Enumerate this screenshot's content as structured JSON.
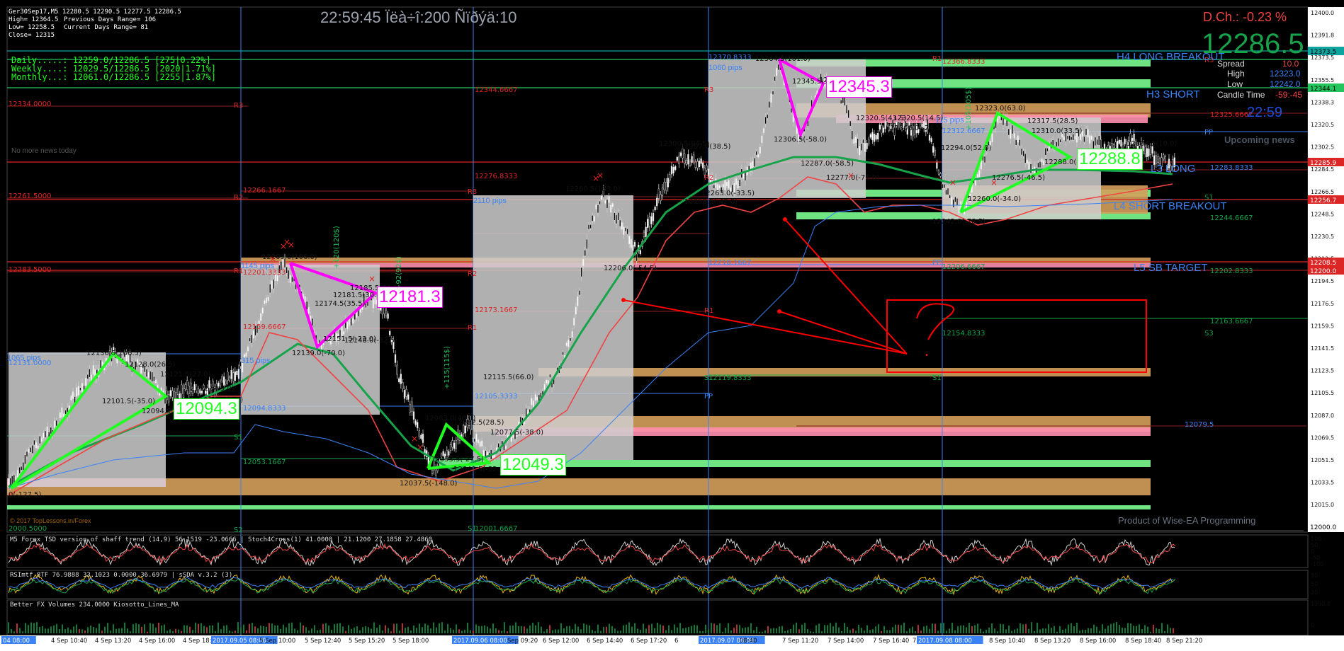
{
  "header": {
    "symbol_line": "Ger30Sep17,M5  12280.5 12290.5 12277.5 12286.5",
    "high": "High= 12364.5",
    "low": "Low= 12258.5",
    "close": "Close= 12315",
    "prev_days_range": "Previous Days Range= 106",
    "current_days_range": "Current Days Range= 81",
    "clock": "22:59:45 Ïëà÷î:200 Ñïðýä:10"
  },
  "summary": {
    "daily": "Daily.....: 12259.0/12286.5 [275|0.22%]",
    "weekly": "Weekly....: 12029.5/12286.5 [2020|1.71%]",
    "monthly": "Monthly...: 12061.0/12286.5 [2255|1.87%]"
  },
  "info_panel": {
    "day_change": "D.Ch.: -0.23 %",
    "price": "12286.5",
    "spread_label": "Spread",
    "spread": "10.0",
    "high_label": "High",
    "high": "12323.0",
    "low_label": "Low",
    "low": "12242.0",
    "candle_time_label": "Candle Time",
    "candle_time": "-59:-45",
    "clock": "22:59",
    "upcoming_news": "Upcoming news"
  },
  "labels": {
    "no_news": "No more news today",
    "copyright": "© 2017 TopLessons.in/Forex",
    "product": "Product of Wise-EA Programming",
    "h4_long": "H4 LONG BREAKOUT",
    "h3_short": "H3 SHORT",
    "l3_long": "L3 LONG",
    "l4_short": "L4 SHORT BREAKOUT",
    "l5_target": "L5 SB TARGET"
  },
  "price_axis": [
    "12400.0",
    "12391.8",
    "12373.5",
    "12355.5",
    "12338.3",
    "12320.5",
    "12302.5",
    "12284.5",
    "12266.5",
    "12248.5",
    "12230.5",
    "12212.5",
    "12194.5",
    "12176.5",
    "12159.5",
    "12141.5",
    "12123.5",
    "12105.5",
    "12087.0",
    "12069.5",
    "12051.5",
    "12033.5",
    "12015.0",
    "11997.5"
  ],
  "price_tags": [
    {
      "text": "12373.5",
      "bg": "#0ea5a0",
      "fg": "#000"
    },
    {
      "text": "12344.1",
      "bg": "#22c55e",
      "fg": "#000"
    },
    {
      "text": "12285.9",
      "bg": "#dc2626",
      "fg": "#fff"
    },
    {
      "text": "12256.7",
      "bg": "#dc2626",
      "fg": "#fff"
    },
    {
      "text": "12208.5",
      "bg": "#dc2626",
      "fg": "#fff"
    },
    {
      "text": "12200.0",
      "bg": "#dc2626",
      "fg": "#fff"
    },
    {
      "text": "12000.0",
      "bg": "#ffffff",
      "fg": "#000"
    }
  ],
  "pattern_labels": [
    {
      "text": "12094.3",
      "color": "#22ff22"
    },
    {
      "text": "12181.3",
      "color": "#ff00ff"
    },
    {
      "text": "12049.3",
      "color": "#22ff22"
    },
    {
      "text": "12345.3",
      "color": "#ff00ff"
    },
    {
      "text": "12288.8",
      "color": "#22ff22"
    }
  ],
  "pips_labels": [
    "1065 pips",
    "1145 pips",
    "315 pips",
    "2110 pips",
    "1060 pips",
    "115 pips"
  ],
  "level_labels": [
    "12334.0000",
    "12261.5000",
    "12283.5000",
    "12131.0000",
    "12266.1667",
    "12201.3333",
    "12159.6667",
    "12094.8333",
    "12053.1667",
    "12344.6667",
    "12276.8333",
    "12173.1667",
    "12105.3333",
    "12370.8333",
    "12210.1667",
    "12119.8333",
    "12366.8333",
    "12312.6667",
    "12206.6667",
    "12154.8333",
    "12325.6667",
    "12283.8333",
    "12244.6667",
    "12202.8333",
    "12163.6667",
    "12079.5",
    "12001.6667",
    "2000.5000"
  ],
  "pivot_letters": [
    "R3",
    "R2",
    "R1",
    "PP",
    "S1",
    "S2",
    "S3"
  ],
  "swing_labels": [
    "12136.5(106.5)",
    "12128.0(26.5)",
    "12121.5(27.0)",
    "12101.5(-35.0)",
    "12094.5(-33.5)",
    "12112.5(-9.0)",
    "12103.0(-18.5)",
    "12209.0(106.0)",
    "12174.5(35.5)",
    "12181.5(30.0)",
    "12185.5(31.5)",
    "12151.5(-23.0)",
    "12148.0(-32.5)",
    "12139.0(-70.0)",
    "12083.0(46.0)",
    "12082.5(28.5)",
    "12077.5(-38.0)",
    "12055.5(-27.5)",
    "12049.5(-32.5)",
    "12037.5(-148.0)",
    "12115.5(66.0)",
    "12260.5(183.0)",
    "12206.0(-54.5)",
    "12300.5(94.5)",
    "12297.0(38.5)",
    "12258.5(-42.0)",
    "12263.0(-33.5)",
    "12364.5(101.0)",
    "12345.5(39.0)",
    "12348.0(61.0)",
    "12306.5(-58.0)",
    "12287.0(-58.5)",
    "12277.0(-71.0)",
    "12320.5(43.5)",
    "12320.5(14.5)",
    "12306.0(-24.5)",
    "12323.0(63.0)",
    "12317.5(28.5)",
    "12310.0(33.5)",
    "12304.5(10.0)",
    "12294.0(52.0)",
    "12288.0(-21.0)",
    "12276.5(-46.5)",
    "12260.0(-34.0)",
    "12242.0(-78.5)",
    "0(-127.5)"
  ],
  "time_axis": [
    "04 08:00",
    "4 Sep 10:40",
    "4 Sep 13:20",
    "4 Sep 16:00",
    "4 Sep 18:",
    "2017.09.05 08:00",
    "5 Sep 10:00",
    "5 Sep 12:40",
    "5 Sep 15:20",
    "5 Sep 18:00",
    "2017.09.06 08:00",
    "Sep 09:20",
    "6 Sep 12:00",
    "6 Sep 14:40",
    "6 Sep 17:20",
    "6",
    "2017.09.07 08:00",
    "08:40",
    "7 Sep 11:20",
    "7 Sep 14:00",
    "7 Sep 16:40",
    "7 Sep",
    "2017.09.08 08:00",
    "8 Sep 10:40",
    "8 Sep 13:20",
    "8 Sep 16:00",
    "8 Sep 18:40",
    "8 Sep 21:20"
  ],
  "subpanels": {
    "tsd": "M5 Forex TSD version of shaff trend (14,9) 56.1519 -23.0666 | Stoch4Cross(1) 41.0000 | 21.1200 27.1858 27.4860",
    "rsi": "RSImtf_8TF 76.9888 33.1023 0.0000 36.6979  | sSDA v.3.2 (3)",
    "vol": "Better FX Volumes 234.0000  Kiosotto_Lines_MA",
    "tsd_scale": [
      "100",
      "50",
      "0",
      "-50",
      "-100"
    ],
    "rsi_scale": [
      "80",
      "50",
      "20"
    ],
    "vol_scale": [
      "1990.8",
      "0"
    ]
  },
  "colors": {
    "background": "#000000",
    "candle": "#cfcfcf",
    "ma_green": "#16a34a",
    "ma_red": "#ef4444",
    "ma_blue": "#3b82f6",
    "pattern_green": "#22ff22",
    "pattern_magenta": "#ff00ff",
    "zone_orange": "#d4a05a",
    "zone_pink": "#ff8fb0",
    "zone_lime": "#7cfc90",
    "annotation_red": "#ff0000"
  }
}
